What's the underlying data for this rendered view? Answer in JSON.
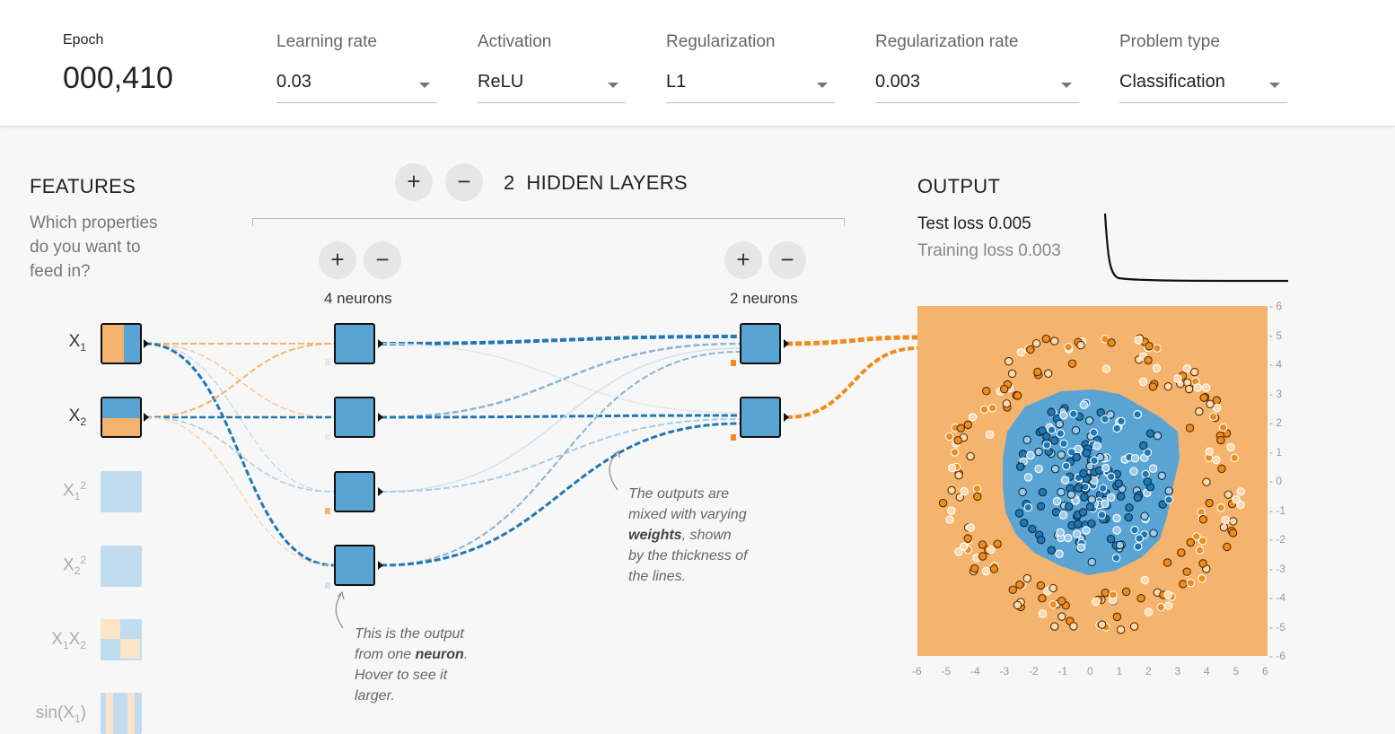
{
  "controls": {
    "epoch": {
      "label": "Epoch",
      "value": "000,410"
    },
    "learning_rate": {
      "label": "Learning rate",
      "value": "0.03"
    },
    "activation": {
      "label": "Activation",
      "value": "ReLU"
    },
    "regularization": {
      "label": "Regularization",
      "value": "L1"
    },
    "regularization_rate": {
      "label": "Regularization rate",
      "value": "0.003"
    },
    "problem_type": {
      "label": "Problem type",
      "value": "Classification"
    }
  },
  "features": {
    "title": "FEATURES",
    "question_lines": [
      "Which properties",
      "do you want to",
      "feed in?"
    ],
    "items": [
      {
        "base": "X",
        "sub": "1",
        "sup": "",
        "base2": "",
        "sub2": "",
        "enabled": true
      },
      {
        "base": "X",
        "sub": "2",
        "sup": "",
        "base2": "",
        "sub2": "",
        "enabled": true
      },
      {
        "base": "X",
        "sub": "1",
        "sup": "2",
        "base2": "",
        "sub2": "",
        "enabled": false
      },
      {
        "base": "X",
        "sub": "2",
        "sup": "2",
        "base2": "",
        "sub2": "",
        "enabled": false
      },
      {
        "base": "X",
        "sub": "1",
        "sup": "",
        "base2": "X",
        "sub2": "2",
        "enabled": false
      },
      {
        "base": "sin(X",
        "sub": "1",
        "sup": "",
        "base2": ")",
        "sub2": "",
        "enabled": false
      }
    ]
  },
  "hidden_layers": {
    "add_symbol": "+",
    "remove_symbol": "−",
    "count": "2",
    "label": "HIDDEN LAYERS",
    "layers": [
      {
        "neurons_label": "4 neurons"
      },
      {
        "neurons_label": "2 neurons"
      }
    ]
  },
  "annotations": {
    "weights": {
      "line1": "The outputs are",
      "line2": "mixed with varying",
      "bold": "weights",
      "line3_rest": ", shown",
      "line4": "by the thickness of",
      "line5": "the lines."
    },
    "neuron": {
      "line1": "This is the output",
      "line2_pre": "from one ",
      "bold": "neuron",
      "line2_post": ".",
      "line3": "Hover to see it",
      "line4": "larger."
    }
  },
  "output": {
    "title": "OUTPUT",
    "test_loss_label": "Test loss",
    "test_loss_value": "0.005",
    "training_loss_label": "Training loss",
    "training_loss_value": "0.003",
    "x_ticks": [
      "-6",
      "-5",
      "-4",
      "-3",
      "-2",
      "-1",
      "0",
      "1",
      "2",
      "3",
      "4",
      "5",
      "6"
    ],
    "y_ticks": [
      "6",
      "5",
      "4",
      "3",
      "2",
      "1",
      "0",
      "-1",
      "-2",
      "-3",
      "-4",
      "-5",
      "-6"
    ]
  },
  "colors": {
    "orange": "#f4b46d",
    "blue": "#5aa4d3",
    "dark_blue": "#1f77b4",
    "dark_orange": "#f08b1e"
  }
}
